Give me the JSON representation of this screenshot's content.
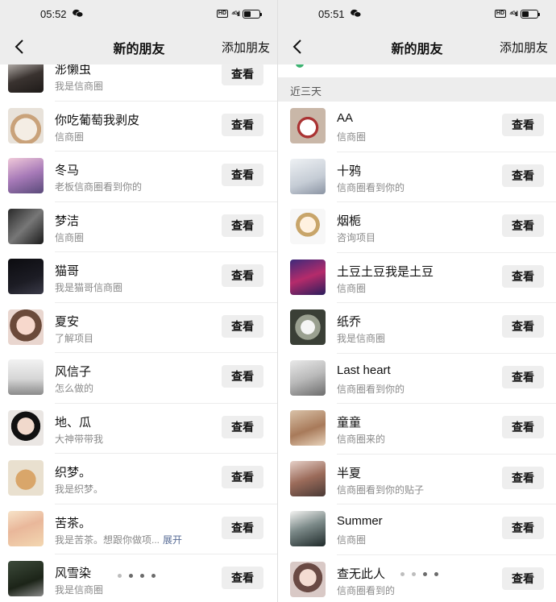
{
  "left": {
    "status": {
      "time": "05:52",
      "hd": "HD",
      "signal": "⁴ᴳıl"
    },
    "nav": {
      "title": "新的朋友",
      "add": "添加朋友"
    },
    "action_label": "查看",
    "expand_label": "展开",
    "rows": [
      {
        "name": "浵懒虫",
        "note": "我是信商圈",
        "avatar": "dark-hair-photo"
      },
      {
        "name": "你吃葡萄我剥皮",
        "note": "信商圈",
        "avatar": "cartoon-bear"
      },
      {
        "name": "冬马",
        "note": "老板信商圈看到你的",
        "avatar": "anime-girl"
      },
      {
        "name": "梦洁",
        "note": "信商圈",
        "avatar": "bw-photo"
      },
      {
        "name": "猫哥",
        "note": "我是猫哥信商圈",
        "avatar": "dark-card"
      },
      {
        "name": "夏安",
        "note": "了解项目",
        "avatar": "girl-portrait"
      },
      {
        "name": "风信子",
        "note": "怎么做的",
        "avatar": "hands-heart"
      },
      {
        "name": "地、瓜",
        "note": "大神带带我",
        "avatar": "boy-portrait"
      },
      {
        "name": "织梦。",
        "note": "我是织梦。",
        "avatar": "dog-photo"
      },
      {
        "name": "苦茶。",
        "note": "我是苦茶。想跟你做项...",
        "avatar": "girl-flowers",
        "expand": true
      },
      {
        "name": "风雪染",
        "note": "我是信商圈",
        "avatar": "dark-character"
      }
    ]
  },
  "right": {
    "status": {
      "time": "05:51",
      "hd": "HD",
      "signal": "⁴ᴳıl"
    },
    "nav": {
      "title": "新的朋友",
      "add": "添加朋友"
    },
    "section_title": "近三天",
    "action_label": "查看",
    "rows": [
      {
        "name": "AA",
        "note": "信商圈",
        "avatar": "cake-photo"
      },
      {
        "name": "十鸦",
        "note": "信商圈看到你的",
        "avatar": "sketch-girl"
      },
      {
        "name": "烟栀",
        "note": "咨询项目",
        "avatar": "cartoon-girl"
      },
      {
        "name": "土豆土豆我是土豆",
        "note": "信商圈",
        "avatar": "stage-photo"
      },
      {
        "name": "纸乔",
        "note": "我是信商圈",
        "avatar": "flower-photo"
      },
      {
        "name": "Last heart",
        "note": "信商圈看到你的",
        "avatar": "man-portrait"
      },
      {
        "name": "童童",
        "note": "信商圈来的",
        "avatar": "child-photo"
      },
      {
        "name": "半夏",
        "note": "信商圈看到你的贴子",
        "avatar": "kid-photo"
      },
      {
        "name": "Summer",
        "note": "信商圈",
        "avatar": "ink-painting"
      },
      {
        "name": "查无此人",
        "note": "信商圈看到的",
        "avatar": "angel-girl"
      }
    ]
  },
  "colors": {
    "nav_bg": "#ededed",
    "button_bg": "#eeeeee",
    "expand_link": "#576b95",
    "note_text": "#8a8a8a"
  }
}
